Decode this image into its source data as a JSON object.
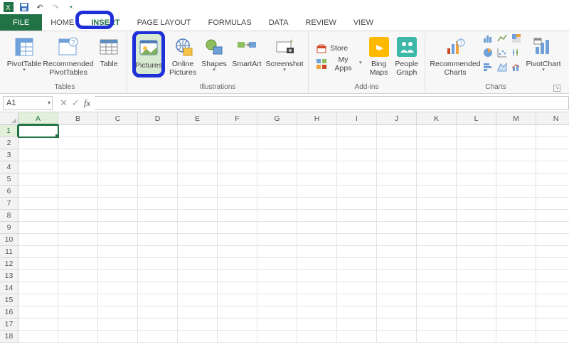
{
  "qat": {
    "tooltip_save": "Save",
    "tooltip_undo": "Undo",
    "tooltip_redo": "Redo"
  },
  "tabs": {
    "file": "FILE",
    "home": "HOME",
    "insert": "INSERT",
    "page_layout": "PAGE LAYOUT",
    "formulas": "FORMULAS",
    "data": "DATA",
    "review": "REVIEW",
    "view": "VIEW"
  },
  "ribbon": {
    "tables": {
      "label": "Tables",
      "pivot": "PivotTable",
      "recpivot": "Recommended\nPivotTables",
      "table": "Table"
    },
    "illus": {
      "label": "Illustrations",
      "pictures": "Pictures",
      "online": "Online\nPictures",
      "shapes": "Shapes",
      "smartart": "SmartArt",
      "screenshot": "Screenshot"
    },
    "addins": {
      "label": "Add-ins",
      "store": "Store",
      "myapps": "My Apps",
      "bing": "Bing\nMaps",
      "people": "People\nGraph"
    },
    "charts": {
      "label": "Charts",
      "rec": "Recommended\nCharts",
      "pivotchart": "PivotChart"
    }
  },
  "formula_bar": {
    "namebox": "A1",
    "fx": "fx"
  },
  "grid": {
    "cols": [
      "A",
      "B",
      "C",
      "D",
      "E",
      "F",
      "G",
      "H",
      "I",
      "J",
      "K",
      "L",
      "M",
      "N"
    ],
    "rows": 18,
    "selected": "A1"
  },
  "highlights": {
    "tab": "insert",
    "button": "pictures"
  }
}
